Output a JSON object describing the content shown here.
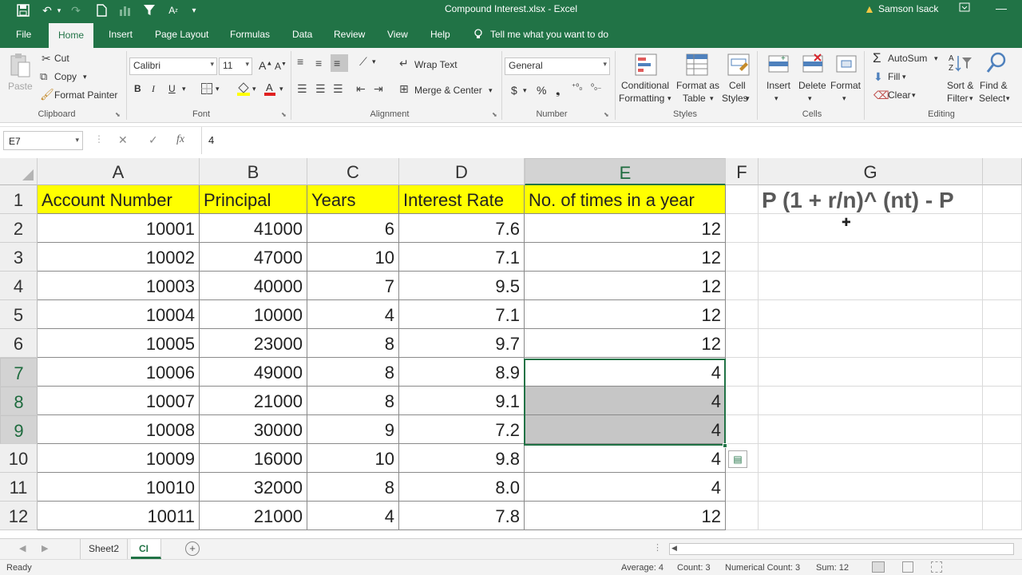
{
  "title": "Compound Interest.xlsx  -  Excel",
  "user": "Samson Isack",
  "tabs": [
    "File",
    "Home",
    "Insert",
    "Page Layout",
    "Formulas",
    "Data",
    "Review",
    "View",
    "Help"
  ],
  "tell_me": "Tell me what you want to do",
  "ribbon": {
    "clipboard": {
      "paste": "Paste",
      "cut": "Cut",
      "copy": "Copy",
      "format_painter": "Format Painter",
      "group": "Clipboard"
    },
    "font": {
      "name": "Calibri",
      "size": "11",
      "group": "Font"
    },
    "alignment": {
      "wrap": "Wrap Text",
      "merge": "Merge & Center",
      "group": "Alignment"
    },
    "number": {
      "format": "General",
      "group": "Number"
    },
    "styles": {
      "cond_1": "Conditional",
      "cond_2": "Formatting",
      "fat_1": "Format as",
      "fat_2": "Table",
      "cell_1": "Cell",
      "cell_2": "Styles",
      "group": "Styles"
    },
    "cells": {
      "insert": "Insert",
      "delete": "Delete",
      "format": "Format",
      "group": "Cells"
    },
    "editing": {
      "autosum": "AutoSum",
      "fill": "Fill",
      "clear": "Clear",
      "sort_1": "Sort &",
      "sort_2": "Filter",
      "find_1": "Find &",
      "find_2": "Select",
      "group": "Editing"
    }
  },
  "formula_bar": {
    "name_box": "E7",
    "fx": "fx",
    "value": "4"
  },
  "columns": [
    "A",
    "B",
    "C",
    "D",
    "E",
    "F",
    "G"
  ],
  "header_row": [
    "Account Number",
    "Principal",
    "Years",
    "Interest Rate",
    "No. of times in a year"
  ],
  "rows": [
    [
      "10001",
      "41000",
      "6",
      "7.6",
      "12"
    ],
    [
      "10002",
      "47000",
      "10",
      "7.1",
      "12"
    ],
    [
      "10003",
      "40000",
      "7",
      "9.5",
      "12"
    ],
    [
      "10004",
      "10000",
      "4",
      "7.1",
      "12"
    ],
    [
      "10005",
      "23000",
      "8",
      "9.7",
      "12"
    ],
    [
      "10006",
      "49000",
      "8",
      "8.9",
      "4"
    ],
    [
      "10007",
      "21000",
      "8",
      "9.1",
      "4"
    ],
    [
      "10008",
      "30000",
      "9",
      "7.2",
      "4"
    ],
    [
      "10009",
      "16000",
      "10",
      "9.8",
      "4"
    ],
    [
      "10010",
      "32000",
      "8",
      "8.0",
      "4"
    ],
    [
      "10011",
      "21000",
      "4",
      "7.8",
      "12"
    ]
  ],
  "row_numbers": [
    "1",
    "2",
    "3",
    "4",
    "5",
    "6",
    "7",
    "8",
    "9",
    "10",
    "11",
    "12"
  ],
  "formula_note": "P (1 + r/n)^ (nt) - P",
  "sheets": [
    "Sheet2",
    "CI"
  ],
  "status": {
    "ready": "Ready",
    "average": "Average: 4",
    "count": "Count: 3",
    "numerical_count": "Numerical Count: 3",
    "sum": "Sum: 12"
  },
  "colors": {
    "accent": "#217346",
    "header_fill": "#ffff00",
    "selection_fill": "#c6c6c6"
  }
}
